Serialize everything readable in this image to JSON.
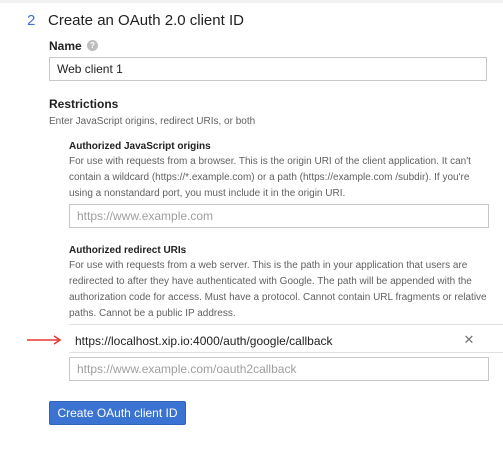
{
  "step": {
    "number": "2",
    "title": "Create an OAuth 2.0 client ID"
  },
  "name": {
    "label": "Name",
    "value": "Web client 1"
  },
  "restrictions": {
    "title": "Restrictions",
    "description": "Enter JavaScript origins, redirect URIs, or both"
  },
  "js_origins": {
    "title": "Authorized JavaScript origins",
    "description": "For use with requests from a browser. This is the origin URI of the client application. It can't contain a wildcard (https://*.example.com) or a path (https://example.com /subdir). If you're using a nonstandard port, you must include it in the origin URI.",
    "placeholder": "https://www.example.com"
  },
  "redirect_uris": {
    "title": "Authorized redirect URIs",
    "description": "For use with requests from a web server. This is the path in your application that users are redirected to after they have authenticated with Google. The path will be appended with the authorization code for access. Must have a protocol. Cannot contain URL fragments or relative paths. Cannot be a public IP address.",
    "entries": [
      "https://localhost.xip.io:4000/auth/google/callback"
    ],
    "placeholder": "https://www.example.com/oauth2callback"
  },
  "create_button": {
    "label": "Create OAuth client ID"
  },
  "icons": {
    "help": "help-icon",
    "remove": "close-icon",
    "annotation": "red-arrow-icon"
  },
  "colors": {
    "accent": "#3a73d2",
    "step_number": "#3f6ecf",
    "annotation_arrow": "#e53935"
  }
}
